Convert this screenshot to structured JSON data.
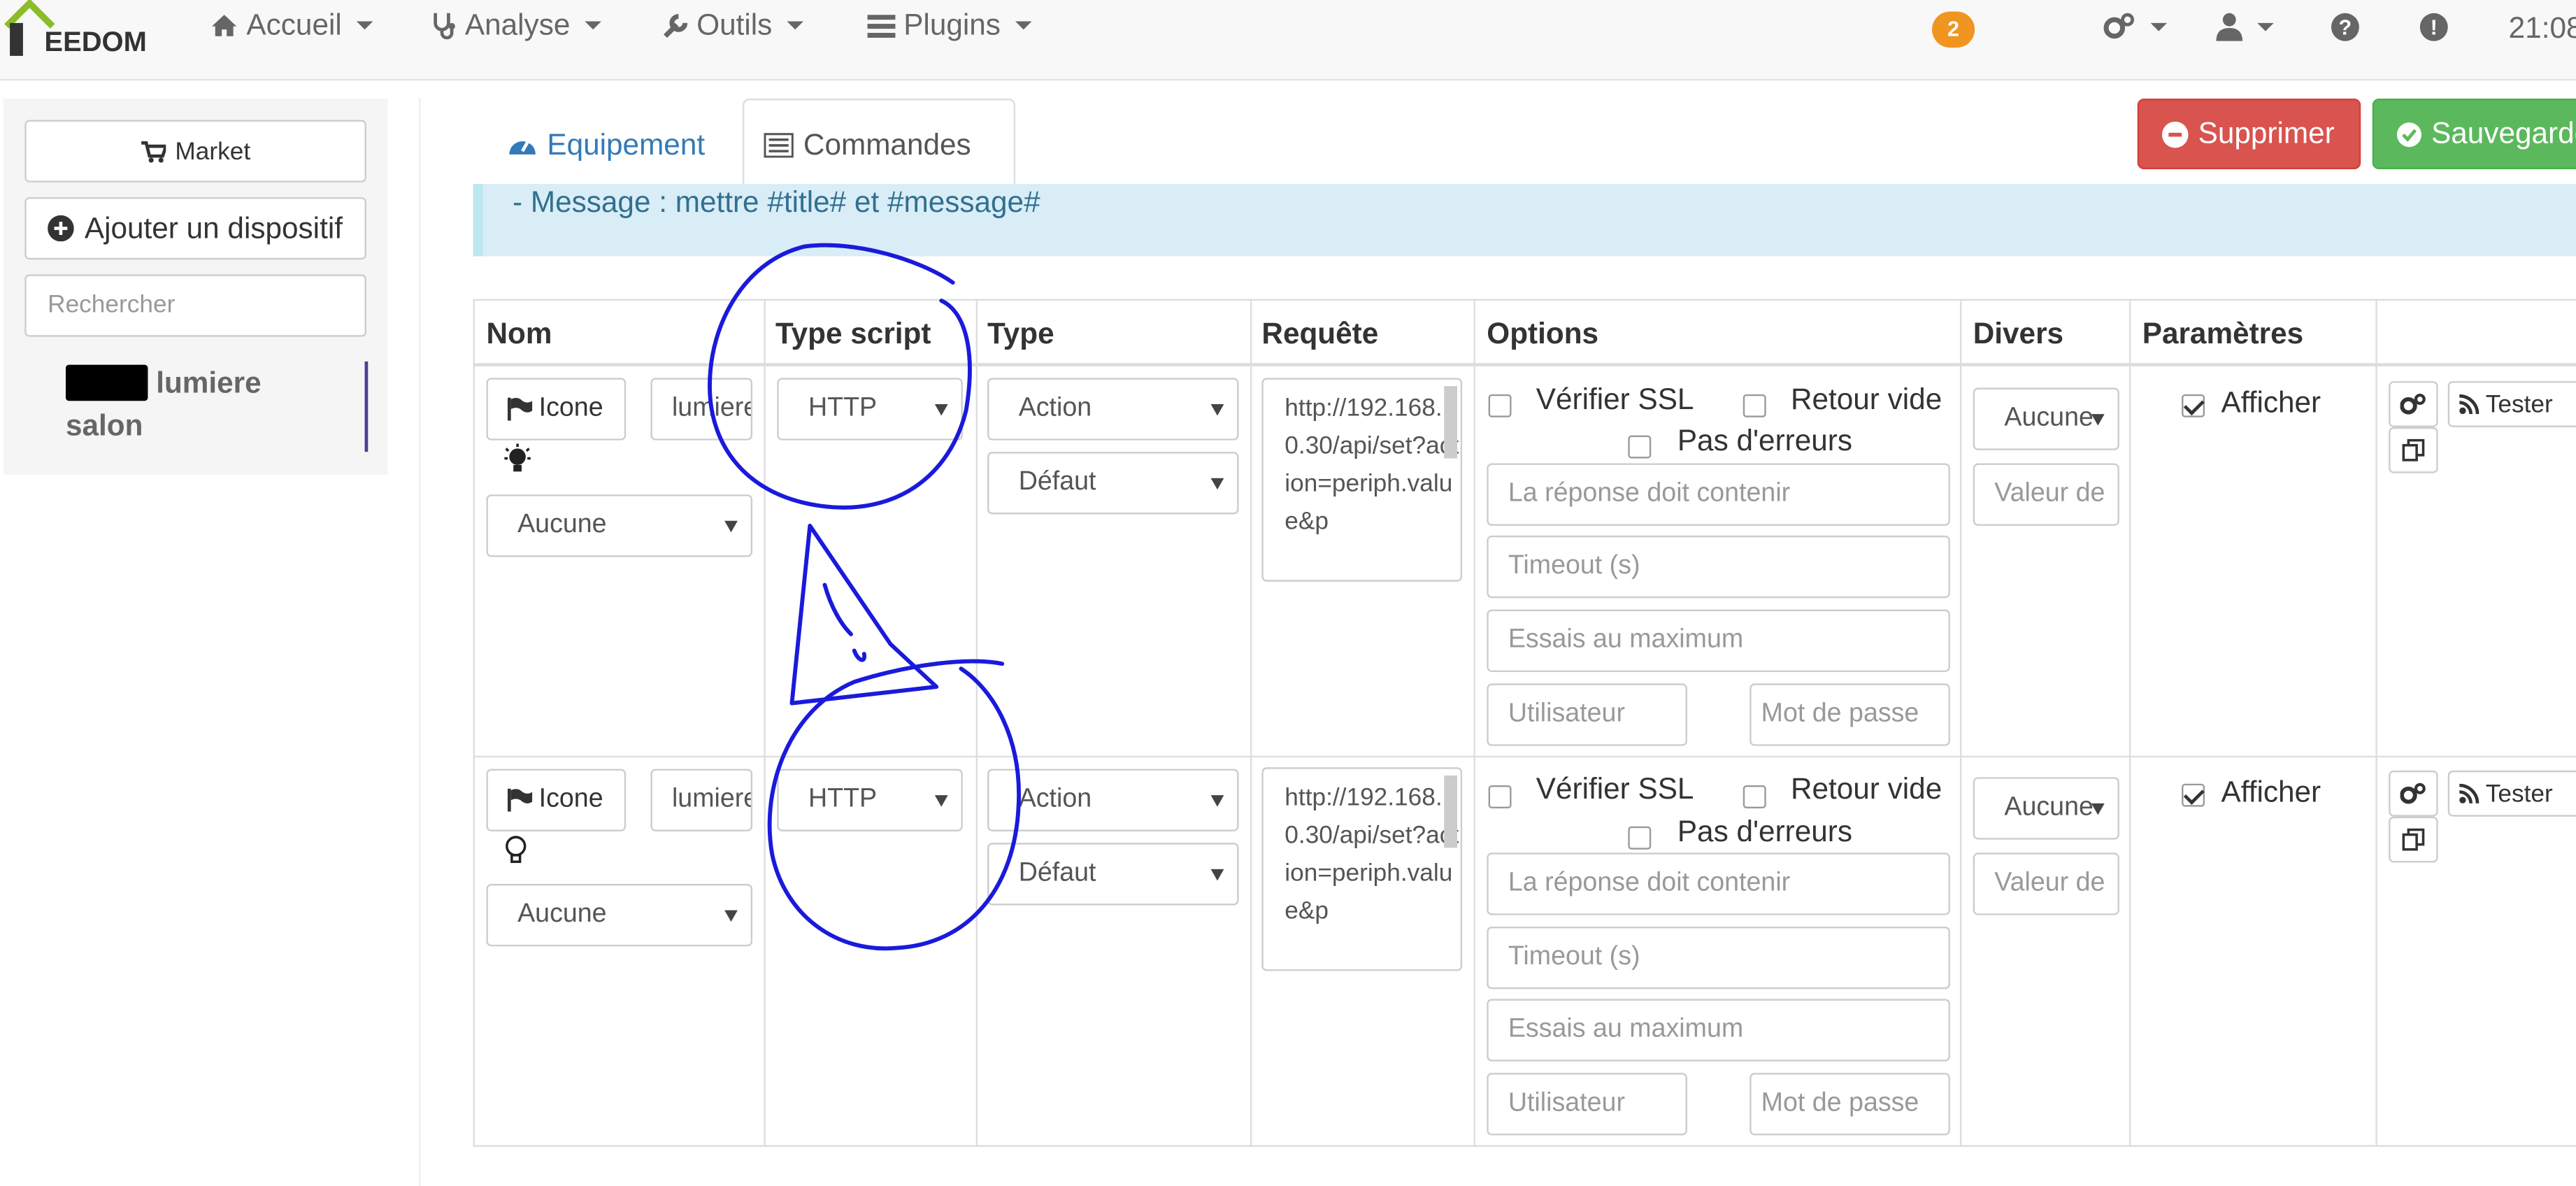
{
  "nav": {
    "logo_text": "EEDOM",
    "items": [
      {
        "label": "Accueil",
        "icon": "home-icon"
      },
      {
        "label": "Analyse",
        "icon": "stethoscope-icon"
      },
      {
        "label": "Outils",
        "icon": "wrench-icon"
      },
      {
        "label": "Plugins",
        "icon": "tasks-icon"
      }
    ],
    "notification_count": "2",
    "time": "21:08"
  },
  "sidebar": {
    "market_label": "Market",
    "add_label": "Ajouter un dispositif",
    "search_placeholder": "Rechercher",
    "device_name": "lumiere salon"
  },
  "tabs": {
    "equipement": "Equipement",
    "commandes": "Commandes"
  },
  "actions": {
    "delete": "Supprimer",
    "save": "Sauvegarder"
  },
  "alert_text": "- Message : mettre #title# et #message#",
  "table": {
    "headers": [
      "Nom",
      "Type script",
      "Type",
      "Requête",
      "Options",
      "Divers",
      "Paramètres"
    ],
    "rows": [
      {
        "icon_button": "Icone",
        "name_value": "lumiere",
        "visibility_select": "Aucune",
        "script_type": "HTTP",
        "type": "Action",
        "subtype": "Défaut",
        "request": "http://192.168.0.30/api/set?action=periph.value&p",
        "ssl_label": "Vérifier SSL",
        "empty_label": "Retour vide",
        "noerror_label": "Pas d'erreurs",
        "response_placeholder": "La réponse doit contenir",
        "timeout_placeholder": "Timeout (s)",
        "retries_placeholder": "Essais au maximum",
        "user_placeholder": "Utilisateur",
        "password_placeholder": "Mot de passe",
        "misc_select": "Aucune",
        "misc_value_placeholder": "Valeur de",
        "show_label": "Afficher",
        "test_label": "Tester"
      },
      {
        "icon_button": "Icone",
        "name_value": "lumiere",
        "visibility_select": "Aucune",
        "script_type": "HTTP",
        "type": "Action",
        "subtype": "Défaut",
        "request": "http://192.168.0.30/api/set?action=periph.value&p",
        "ssl_label": "Vérifier SSL",
        "empty_label": "Retour vide",
        "noerror_label": "Pas d'erreurs",
        "response_placeholder": "La réponse doit contenir",
        "timeout_placeholder": "Timeout (s)",
        "retries_placeholder": "Essais au maximum",
        "user_placeholder": "Utilisateur",
        "password_placeholder": "Mot de passe",
        "misc_select": "Aucune",
        "misc_value_placeholder": "Valeur de",
        "show_label": "Afficher",
        "test_label": "Tester"
      }
    ]
  },
  "colors": {
    "delete": "#d9534f",
    "save": "#5cb85c",
    "badge": "#f0951f",
    "link": "#337ab7",
    "alert_bg": "#d9edf7",
    "annotation": "#1a1adc"
  }
}
